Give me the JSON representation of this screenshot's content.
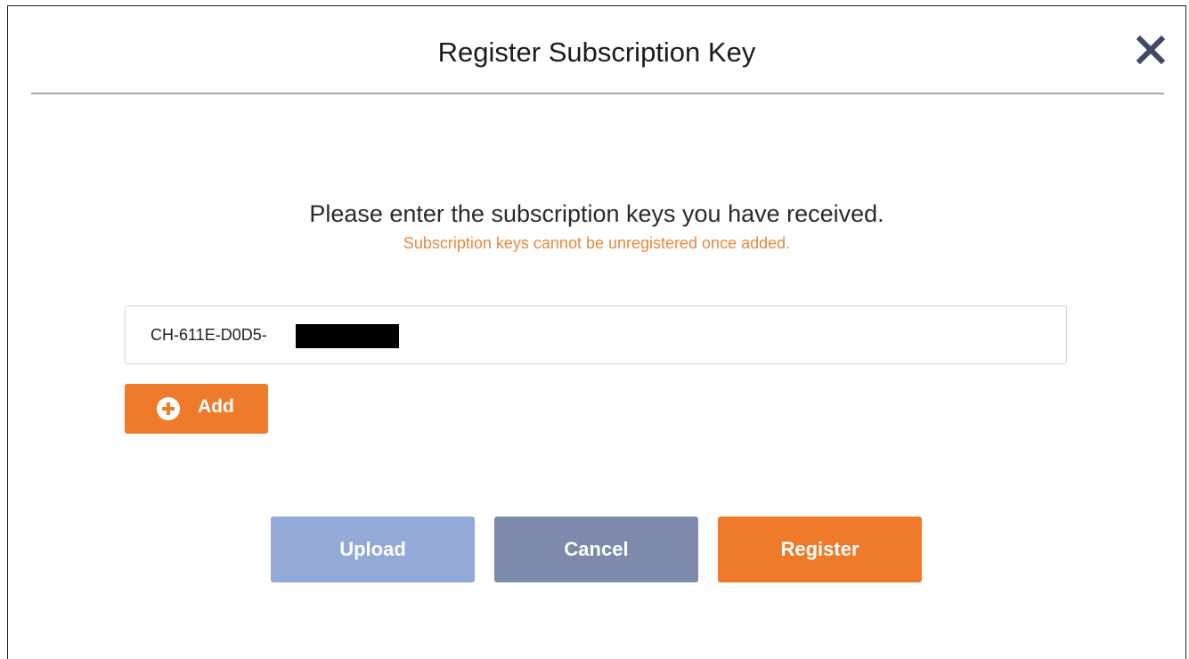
{
  "dialog": {
    "title": "Register Subscription Key",
    "prompt": "Please enter the subscription keys you have received.",
    "warning": "Subscription keys cannot be unregistered once added."
  },
  "key_input": {
    "value": "CH-611E-D0D5-"
  },
  "add_button": {
    "label": "Add",
    "icon": "plus-circle-icon"
  },
  "actions": {
    "upload_label": "Upload",
    "cancel_label": "Cancel",
    "register_label": "Register"
  },
  "icons": {
    "close": "close-icon"
  },
  "colors": {
    "accent": "#ee7a2a",
    "warning_text": "#e8893e",
    "upload_button": "#93a9d8",
    "cancel_button": "#7d8aab",
    "close_icon": "#3f4a66"
  }
}
